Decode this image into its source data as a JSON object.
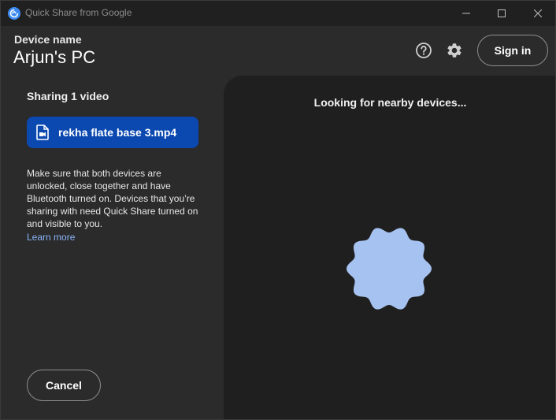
{
  "window": {
    "title": "Quick Share from Google",
    "controls": [
      "minimize",
      "maximize",
      "close"
    ]
  },
  "header": {
    "device_label": "Device name",
    "device_name": "Arjun's PC",
    "help_icon": "help-circle-icon",
    "settings_icon": "gear-icon",
    "signin_label": "Sign in"
  },
  "left": {
    "sharing_title": "Sharing 1 video",
    "file": {
      "icon": "video-file-icon",
      "name": "rekha flate base 3.mp4"
    },
    "help_text": "Make sure that both devices are unlocked, close together and have Bluetooth turned on. Devices that you’re sharing with need Quick Share turned on and visible to you.",
    "learn_more": "Learn more",
    "cancel_label": "Cancel"
  },
  "right": {
    "status_text": "Looking for nearby devices..."
  },
  "colors": {
    "background": "#2b2b2b",
    "titlebar": "#202020",
    "right_panel": "#1f1f1f",
    "file_chip": "#0b48b0",
    "link": "#8ab4f8",
    "blob": "#a6c2f0"
  }
}
